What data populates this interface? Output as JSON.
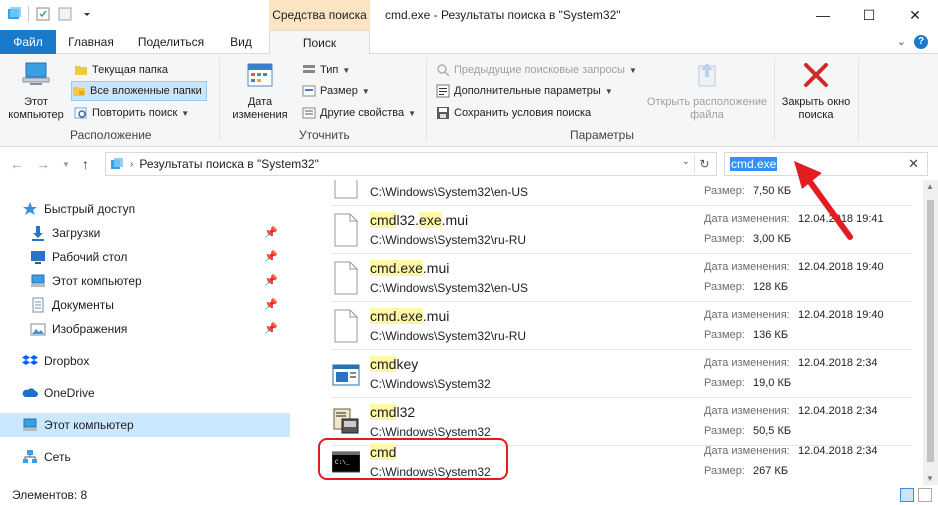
{
  "titlebar": {
    "context_tab": "Средства поиска",
    "title": "cmd.exe - Результаты поиска в \"System32\"",
    "minimize": "—",
    "maximize": "☐",
    "close": "✕"
  },
  "tabs": {
    "file": "Файл",
    "home": "Главная",
    "share": "Поделиться",
    "view": "Вид",
    "search": "Поиск",
    "expand": "⌄",
    "help": "?"
  },
  "ribbon": {
    "location": {
      "this_pc": "Этот компьютер",
      "current_folder": "Текущая папка",
      "all_subfolders": "Все вложенные папки",
      "search_again": "Повторить поиск",
      "group_label": "Расположение"
    },
    "refine": {
      "date_modified": "Дата изменения",
      "kind": "Тип",
      "size": "Размер",
      "other_props": "Другие свойства",
      "group_label": "Уточнить"
    },
    "options": {
      "recent_searches": "Предыдущие поисковые запросы",
      "advanced": "Дополнительные параметры",
      "save_search": "Сохранить условия поиска",
      "open_location": "Открыть расположение файла",
      "group_label": "Параметры"
    },
    "close_search": "Закрыть окно поиска"
  },
  "address": {
    "path": "Результаты поиска в \"System32\"",
    "search_value": "cmd.exe",
    "clear": "✕",
    "refresh": "↻"
  },
  "sidebar": {
    "items": [
      {
        "label": "Быстрый доступ",
        "icon": "star-icon"
      },
      {
        "label": "Загрузки",
        "icon": "download-icon",
        "pinned": true
      },
      {
        "label": "Рабочий стол",
        "icon": "desktop-icon",
        "pinned": true
      },
      {
        "label": "Этот компьютер",
        "icon": "computer-icon",
        "pinned": true
      },
      {
        "label": "Документы",
        "icon": "documents-icon",
        "pinned": true
      },
      {
        "label": "Изображения",
        "icon": "pictures-icon",
        "pinned": true
      },
      {
        "label": "Dropbox",
        "icon": "dropbox-icon"
      },
      {
        "label": "OneDrive",
        "icon": "onedrive-icon"
      },
      {
        "label": "Этот компьютер",
        "icon": "computer-icon",
        "selected": true
      },
      {
        "label": "Сеть",
        "icon": "network-icon"
      }
    ]
  },
  "results": {
    "date_label": "Дата изменения:",
    "size_label": "Размер:",
    "items": [
      {
        "name_parts": [],
        "path": "C:\\Windows\\System32\\en-US",
        "date": "",
        "size": "7,50 КБ",
        "icon": "file-icon"
      },
      {
        "name_parts": [
          [
            "cmd",
            true
          ],
          [
            "l32.",
            false
          ],
          [
            "exe",
            true
          ],
          [
            ".mui",
            false
          ]
        ],
        "path": "C:\\Windows\\System32\\ru-RU",
        "date": "12.04.2018 19:41",
        "size": "3,00 КБ",
        "icon": "file-icon"
      },
      {
        "name_parts": [
          [
            "cmd.exe",
            true
          ],
          [
            ".mui",
            false
          ]
        ],
        "path": "C:\\Windows\\System32\\en-US",
        "date": "12.04.2018 19:40",
        "size": "128 КБ",
        "icon": "file-icon"
      },
      {
        "name_parts": [
          [
            "cmd.exe",
            true
          ],
          [
            ".mui",
            false
          ]
        ],
        "path": "C:\\Windows\\System32\\ru-RU",
        "date": "12.04.2018 19:40",
        "size": "136 КБ",
        "icon": "file-icon"
      },
      {
        "name_parts": [
          [
            "cmd",
            true
          ],
          [
            "key",
            false
          ]
        ],
        "path": "C:\\Windows\\System32",
        "date": "12.04.2018 2:34",
        "size": "19,0 КБ",
        "icon": "app-window-icon"
      },
      {
        "name_parts": [
          [
            "cmd",
            true
          ],
          [
            "l32",
            false
          ]
        ],
        "path": "C:\\Windows\\System32",
        "date": "12.04.2018 2:34",
        "size": "50,5 КБ",
        "icon": "cmdl32-icon"
      },
      {
        "name_parts": [
          [
            "cmd",
            true
          ]
        ],
        "path": "C:\\Windows\\System32",
        "date": "12.04.2018 2:34",
        "size": "267 КБ",
        "icon": "console-icon"
      }
    ]
  },
  "status": {
    "count": "Элементов: 8"
  },
  "colors": {
    "accent": "#1979ca",
    "context_tab": "#fbe4c2",
    "highlight": "#fff7a6",
    "annotation": "#e31b23"
  }
}
